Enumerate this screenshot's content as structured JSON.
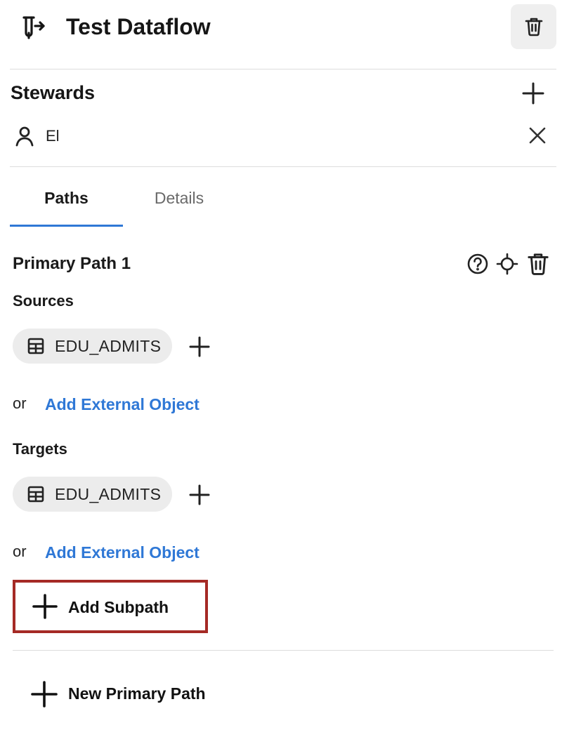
{
  "header": {
    "title": "Test Dataflow",
    "icon": "dataflow-icon",
    "delete_icon": "trash-icon"
  },
  "stewards": {
    "title": "Stewards",
    "add_icon": "plus-icon",
    "users": [
      {
        "name": "El",
        "icon": "user-icon",
        "remove_icon": "close-icon"
      }
    ]
  },
  "tabs": [
    {
      "label": "Paths",
      "active": true
    },
    {
      "label": "Details",
      "active": false
    }
  ],
  "primary_path": {
    "title": "Primary Path 1",
    "tool_icons": [
      "help-circle-icon",
      "crosshair-icon",
      "trash-icon"
    ],
    "sources": {
      "label": "Sources",
      "items": [
        {
          "name": "EDU_ADMITS",
          "icon": "table-icon"
        }
      ],
      "or_text": "or",
      "external_link": "Add External Object"
    },
    "targets": {
      "label": "Targets",
      "items": [
        {
          "name": "EDU_ADMITS",
          "icon": "table-icon"
        }
      ],
      "or_text": "or",
      "external_link": "Add External Object"
    },
    "add_subpath_label": "Add Subpath"
  },
  "new_primary_path_label": "New Primary Path",
  "colors": {
    "accent": "#2f78d6",
    "highlight_border": "#a52a25",
    "chip_bg": "#ececec"
  }
}
